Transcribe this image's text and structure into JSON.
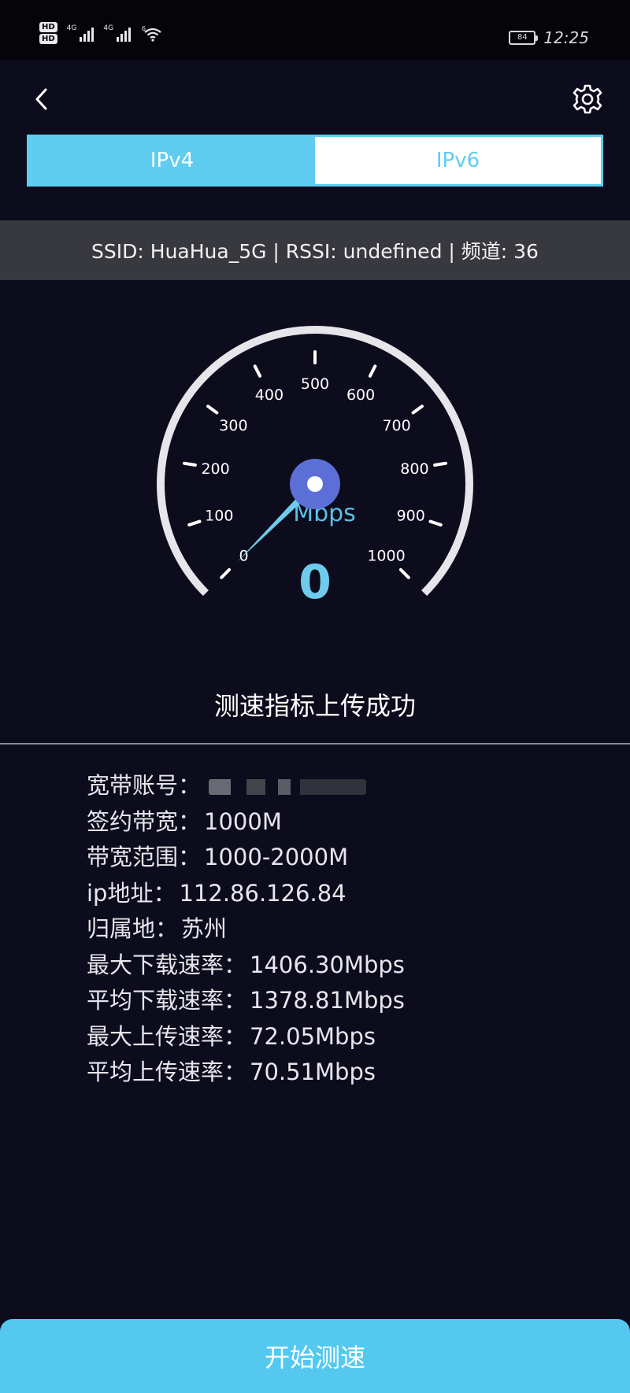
{
  "status_bar": {
    "hd1": "HD",
    "hd2": "HD",
    "net1": "4G",
    "net2": "4G",
    "net3": "6",
    "battery": "84",
    "time": "12:25"
  },
  "nav": {
    "back_icon": "chevron-left-icon",
    "settings_icon": "gear-icon"
  },
  "tabs": [
    {
      "label": "IPv4",
      "active": true
    },
    {
      "label": "IPv6",
      "active": false
    }
  ],
  "ssid_bar": "SSID: HuaHua_5G | RSSI: undefined | 频道: 36",
  "gauge": {
    "ticks": [
      "0",
      "100",
      "200",
      "300",
      "400",
      "500",
      "600",
      "700",
      "800",
      "900",
      "1000"
    ],
    "unit": "Mbps",
    "value": 0,
    "display_value": "0",
    "max": 1000
  },
  "upload_status": "测速指标上传成功",
  "info": {
    "account_label": "宽带账号：",
    "bandwidth_label": "签约带宽：",
    "bandwidth_value": "1000M",
    "range_label": "带宽范围：",
    "range_value": "1000-2000M",
    "ip_label": "ip地址：",
    "ip_value": "112.86.126.84",
    "location_label": "归属地：",
    "location_value": "苏州",
    "max_down_label": "最大下载速率：",
    "max_down_value": "1406.30Mbps",
    "avg_down_label": "平均下载速率：",
    "avg_down_value": "1378.81Mbps",
    "max_up_label": "最大上传速率：",
    "max_up_value": "72.05Mbps",
    "avg_up_label": "平均上传速率：",
    "avg_up_value": "70.51Mbps"
  },
  "start_button": "开始测速",
  "colors": {
    "background": "#0c0c1d",
    "accent": "#5fcdf0",
    "gauge_arc": "#e6e6ea",
    "needle_hub": "#5b6fd6"
  }
}
